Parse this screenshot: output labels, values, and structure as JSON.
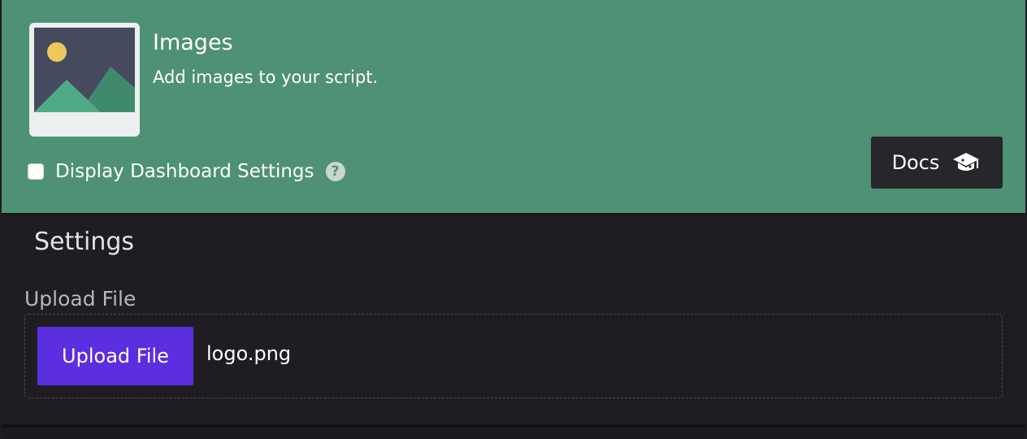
{
  "header": {
    "title": "Images",
    "subtitle": "Add images to your script.",
    "checkbox_label": "Display Dashboard Settings",
    "checkbox_checked": false,
    "help_icon": "question-circle-icon",
    "docs_label": "Docs",
    "docs_icon": "graduation-cap-icon",
    "thumbnail_icon": "image-landscape-icon",
    "background_color": "#4e9175"
  },
  "settings": {
    "title": "Settings",
    "upload": {
      "field_label": "Upload File",
      "button_label": "Upload File",
      "file_name": "logo.png",
      "button_color": "#5b2ee0"
    }
  }
}
